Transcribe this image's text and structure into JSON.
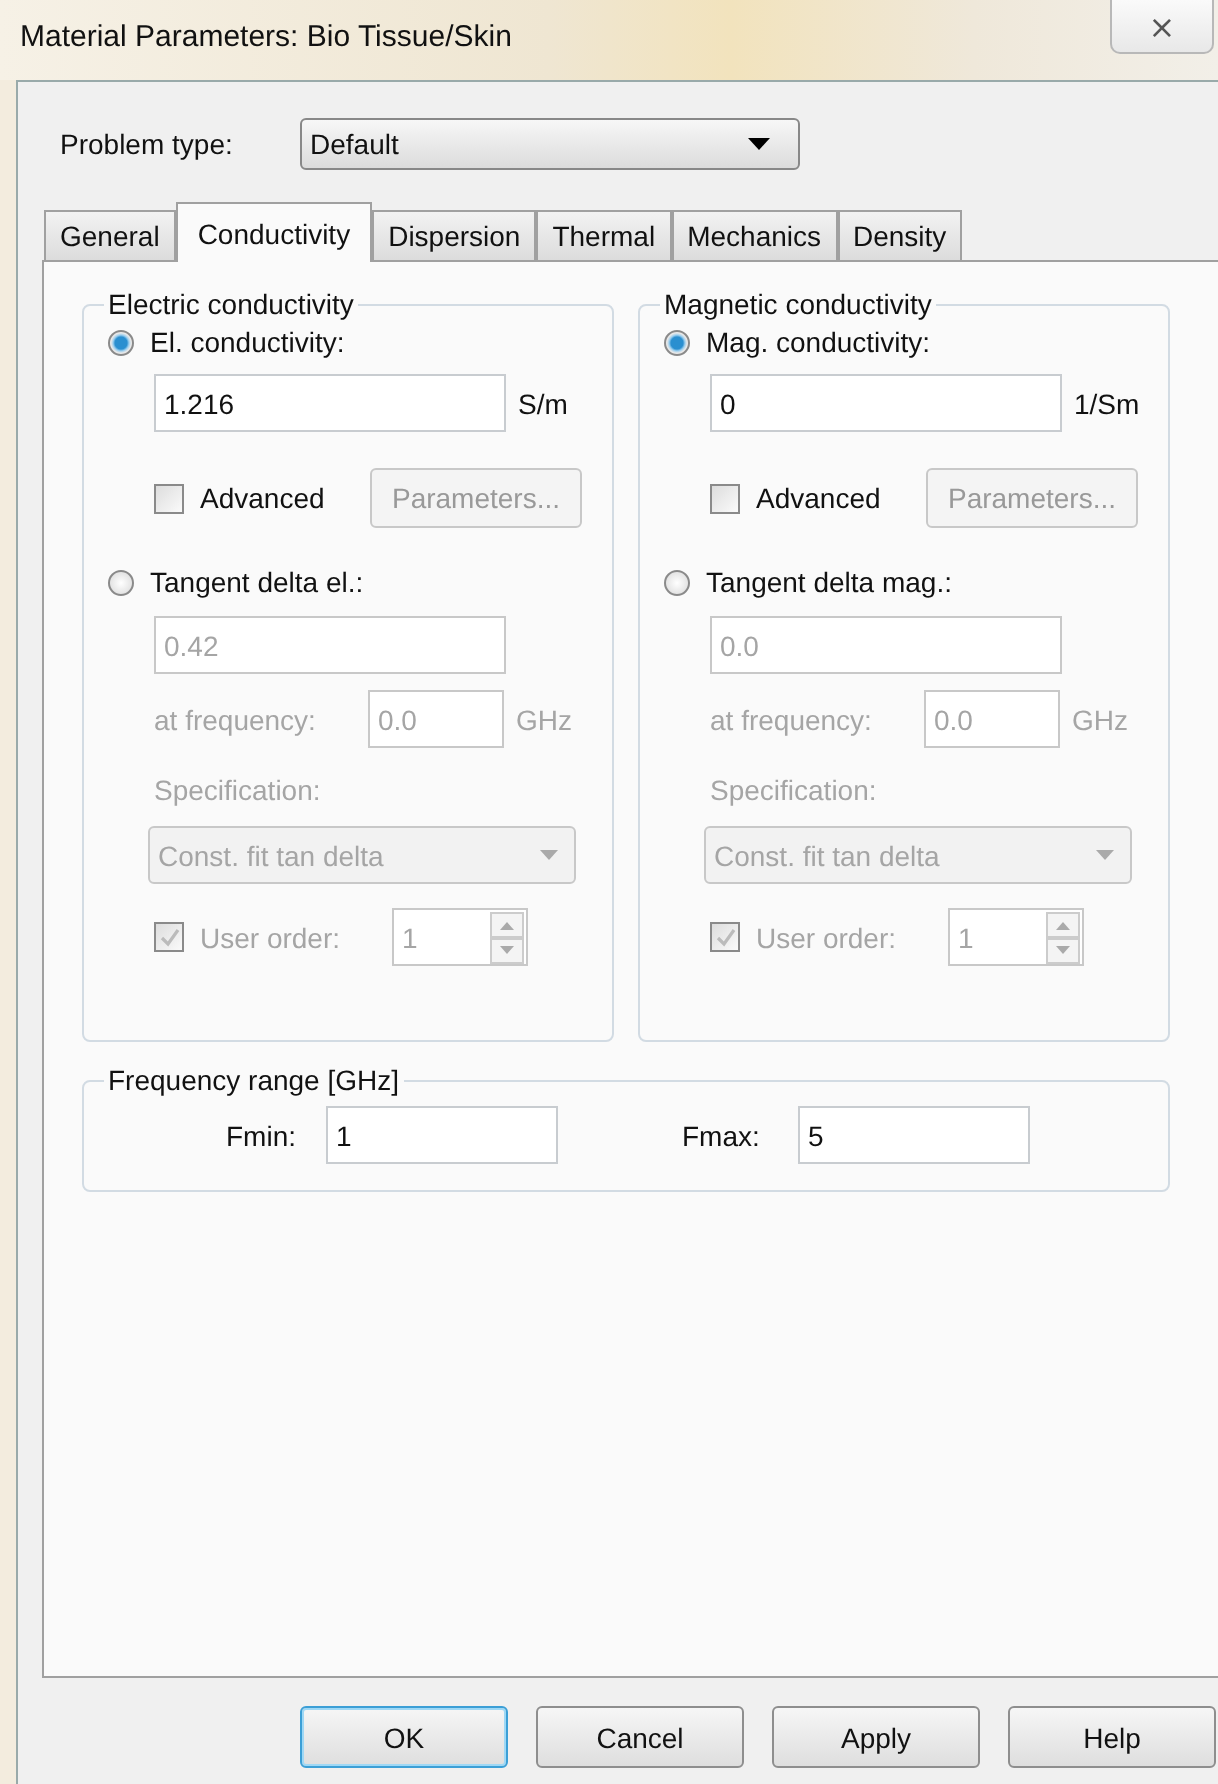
{
  "window": {
    "title": "Material Parameters: Bio Tissue/Skin",
    "close": "⨯"
  },
  "problem_type": {
    "label": "Problem type:",
    "value": "Default"
  },
  "tabs": [
    {
      "label": "General",
      "selected": false
    },
    {
      "label": "Conductivity",
      "selected": true
    },
    {
      "label": "Dispersion",
      "selected": false
    },
    {
      "label": "Thermal",
      "selected": false
    },
    {
      "label": "Mechanics",
      "selected": false
    },
    {
      "label": "Density",
      "selected": false
    }
  ],
  "groups": [
    {
      "title": "Electric conductivity",
      "main_option": {
        "label": "El. conductivity:",
        "selected": true
      },
      "value": "1.216",
      "unit": "S/m",
      "advanced": {
        "label": "Advanced",
        "checked": false
      },
      "parameters_button": {
        "label": "Parameters...",
        "disabled": true
      },
      "tangent_option": {
        "label": "Tangent delta el.:",
        "selected": false
      },
      "tangent_value": "0.42",
      "frequency_label": "at frequency:",
      "frequency_value": "0.0",
      "frequency_unit": "GHz",
      "specification_label": "Specification:",
      "specification_value": "Const. fit tan delta",
      "user_order": {
        "label": "User order:",
        "checked": true,
        "value": "1"
      },
      "tangent_disabled": true
    },
    {
      "title": "Magnetic conductivity",
      "main_option": {
        "label": "Mag. conductivity:",
        "selected": true
      },
      "value": "0",
      "unit": "1/Sm",
      "advanced": {
        "label": "Advanced",
        "checked": false
      },
      "parameters_button": {
        "label": "Parameters...",
        "disabled": true
      },
      "tangent_option": {
        "label": "Tangent delta mag.:",
        "selected": false
      },
      "tangent_value": "0.0",
      "frequency_label": "at frequency:",
      "frequency_value": "0.0",
      "frequency_unit": "GHz",
      "specification_label": "Specification:",
      "specification_value": "Const. fit tan delta",
      "user_order": {
        "label": "User order:",
        "checked": true,
        "value": "1"
      },
      "tangent_disabled": true
    }
  ],
  "frequency_range": {
    "title": "Frequency range [GHz]",
    "fmin_label": "Fmin:",
    "fmin": "1",
    "fmax_label": "Fmax:",
    "fmax": "5"
  },
  "buttons": [
    {
      "label": "OK",
      "default": true
    },
    {
      "label": "Cancel",
      "default": false
    },
    {
      "label": "Apply",
      "default": false
    },
    {
      "label": "Help",
      "default": false
    }
  ]
}
